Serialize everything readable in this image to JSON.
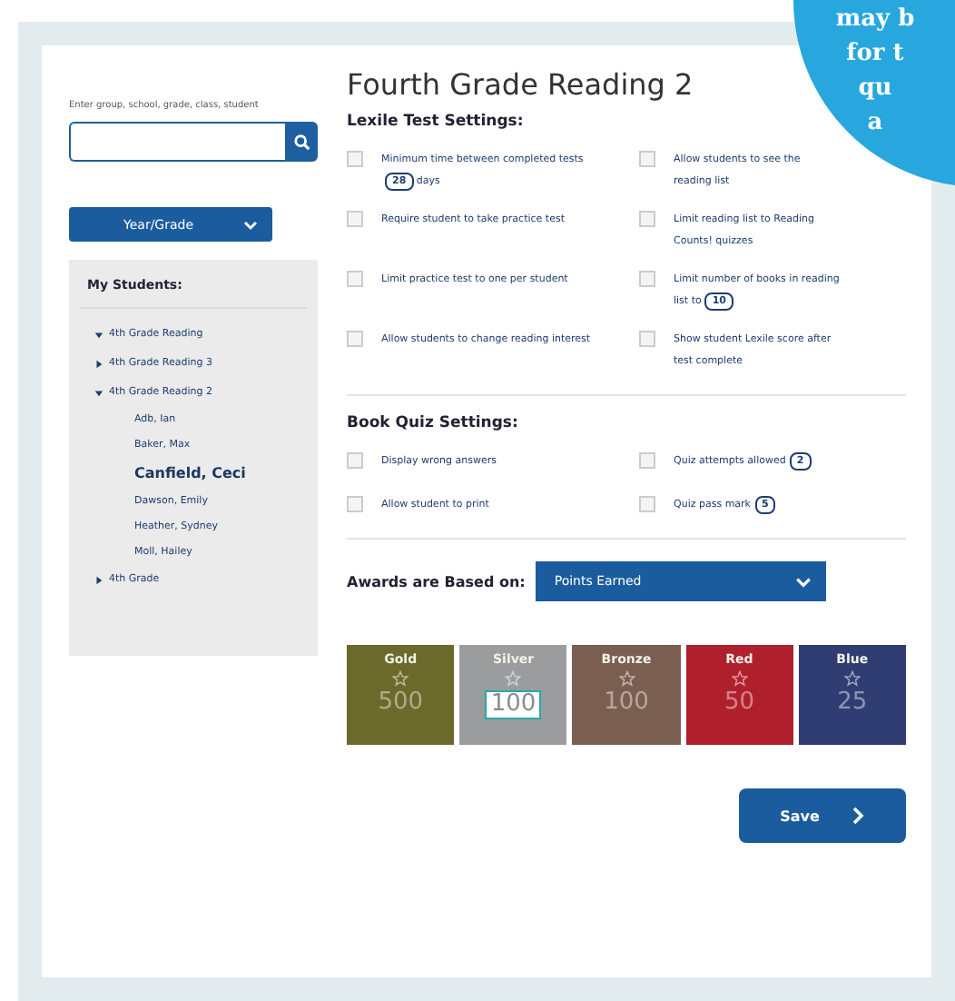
{
  "sidebar": {
    "search_label": "Enter group, school, grade, class, student",
    "filter_select": {
      "value": "Year/Grade"
    },
    "students": {
      "title": "My Students:",
      "items": [
        {
          "label": "4th Grade Reading",
          "expanded": true,
          "selected": false
        },
        {
          "label": "4th Grade Reading 3",
          "expanded": false,
          "selected": false
        },
        {
          "label": "4th Grade Reading 2",
          "expanded": true,
          "selected": false,
          "children": [
            {
              "label": "Adb, Ian",
              "selected": false
            },
            {
              "label": "Baker, Max",
              "selected": false
            },
            {
              "label": "Canfield, Ceci",
              "selected": true
            },
            {
              "label": "Dawson, Emily",
              "selected": false
            },
            {
              "label": "Heather, Sydney",
              "selected": false
            },
            {
              "label": "Moll, Hailey",
              "selected": false
            }
          ]
        },
        {
          "label": "4th Grade",
          "expanded": false,
          "selected": false
        }
      ]
    }
  },
  "title": "Fourth Grade Reading 2",
  "lexile": {
    "title": "Lexile Test Settings:",
    "options": [
      {
        "text": "Minimum time between completed tests",
        "value": "28",
        "after": "days",
        "checked": false
      },
      {
        "text": "Allow students to see the reading list",
        "checked": false
      },
      {
        "text": "Require student to take practice test",
        "checked": false
      },
      {
        "text": "Limit reading list to Reading Counts! quizzes",
        "checked": false
      },
      {
        "text": "Limit practice test to one per student",
        "checked": false
      },
      {
        "text": "Limit number of books in reading list to",
        "value": "10",
        "checked": false
      },
      {
        "text": "Allow students to change reading interest",
        "checked": false
      },
      {
        "text": "Show student Lexile score after test complete",
        "checked": false
      }
    ]
  },
  "book_quiz": {
    "title": "Book Quiz Settings:",
    "options": [
      {
        "text": "Display wrong answers",
        "checked": false
      },
      {
        "text": "Quiz attempts allowed",
        "value": "2",
        "checked": false
      },
      {
        "text": "Allow student to print",
        "checked": false
      },
      {
        "text": "Quiz pass mark",
        "value": "5",
        "checked": false
      }
    ]
  },
  "awards": {
    "label": "Awards are Based on:",
    "select": "Points Earned",
    "medals": [
      {
        "name": "Gold",
        "value": "500",
        "color": "#6b6a2a",
        "selected": false
      },
      {
        "name": "Silver",
        "value": "100",
        "color": "#9a9c9e",
        "selected": true
      },
      {
        "name": "Bronze",
        "value": "100",
        "color": "#7a5e50",
        "selected": false
      },
      {
        "name": "Red",
        "value": "50",
        "color": "#b0202c",
        "selected": false
      },
      {
        "name": "Blue",
        "value": "25",
        "color": "#2f3d72",
        "selected": false
      }
    ]
  },
  "save_button": "Save",
  "callout": {
    "lines": [
      "may b",
      "for t",
      "qu",
      "a"
    ]
  }
}
